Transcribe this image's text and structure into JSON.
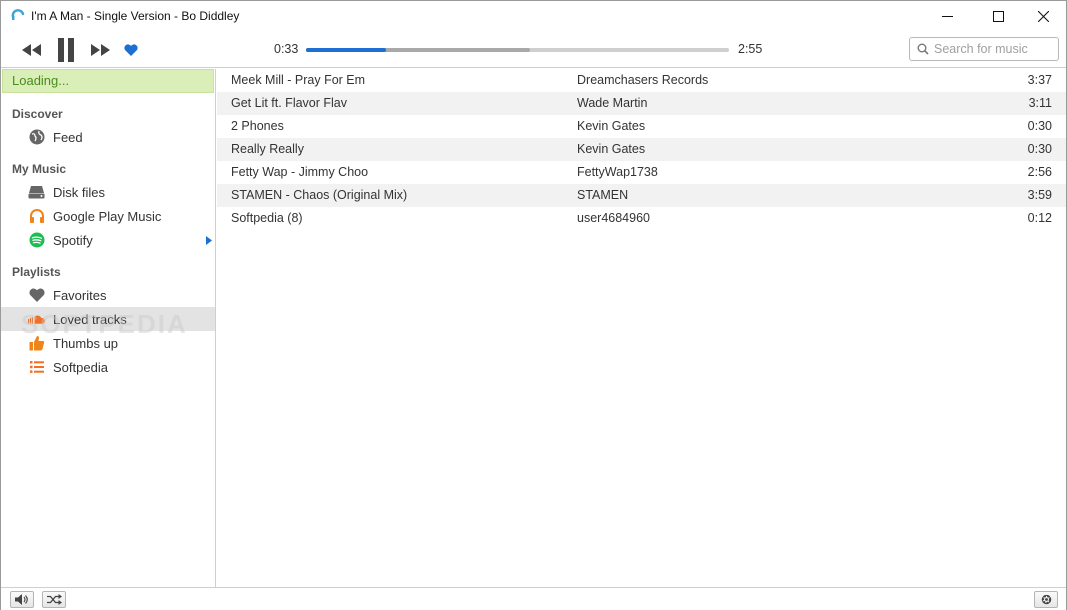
{
  "window": {
    "title": "I'm A Man - Single Version - Bo Diddley"
  },
  "player": {
    "elapsed": "0:33",
    "duration": "2:55",
    "progress_fraction": 0.189,
    "buffered_fraction": 0.53,
    "accent_color": "#1d6fd1"
  },
  "search": {
    "placeholder": "Search for music",
    "value": ""
  },
  "sidebar": {
    "loading": "Loading...",
    "sections": [
      {
        "heading": "Discover",
        "items": [
          {
            "label": "Feed",
            "icon": "globe-icon"
          }
        ]
      },
      {
        "heading": "My Music",
        "items": [
          {
            "label": "Disk files",
            "icon": "hard-drive-icon"
          },
          {
            "label": "Google Play Music",
            "icon": "headphones-icon"
          },
          {
            "label": "Spotify",
            "icon": "spotify-icon"
          }
        ]
      },
      {
        "heading": "Playlists",
        "items": [
          {
            "label": "Favorites",
            "icon": "heart-icon"
          },
          {
            "label": "Loved tracks",
            "icon": "soundcloud-icon"
          },
          {
            "label": "Thumbs up",
            "icon": "thumbs-up-icon"
          },
          {
            "label": "Softpedia",
            "icon": "list-icon"
          }
        ]
      }
    ],
    "watermark": "SOFTPEDIA"
  },
  "tracks": [
    {
      "title": "Meek Mill - Pray For Em",
      "artist": "Dreamchasers Records",
      "duration": "3:37"
    },
    {
      "title": "Get Lit ft. Flavor Flav",
      "artist": "Wade Martin",
      "duration": "3:11"
    },
    {
      "title": "2 Phones",
      "artist": "Kevin Gates",
      "duration": "0:30"
    },
    {
      "title": "Really Really",
      "artist": "Kevin Gates",
      "duration": "0:30"
    },
    {
      "title": "Fetty Wap - Jimmy Choo",
      "artist": "FettyWap1738",
      "duration": "2:56"
    },
    {
      "title": "STAMEN - Chaos (Original Mix)",
      "artist": "STAMEN",
      "duration": "3:59"
    },
    {
      "title": "Softpedia (8)",
      "artist": "user4684960",
      "duration": "0:12"
    }
  ]
}
